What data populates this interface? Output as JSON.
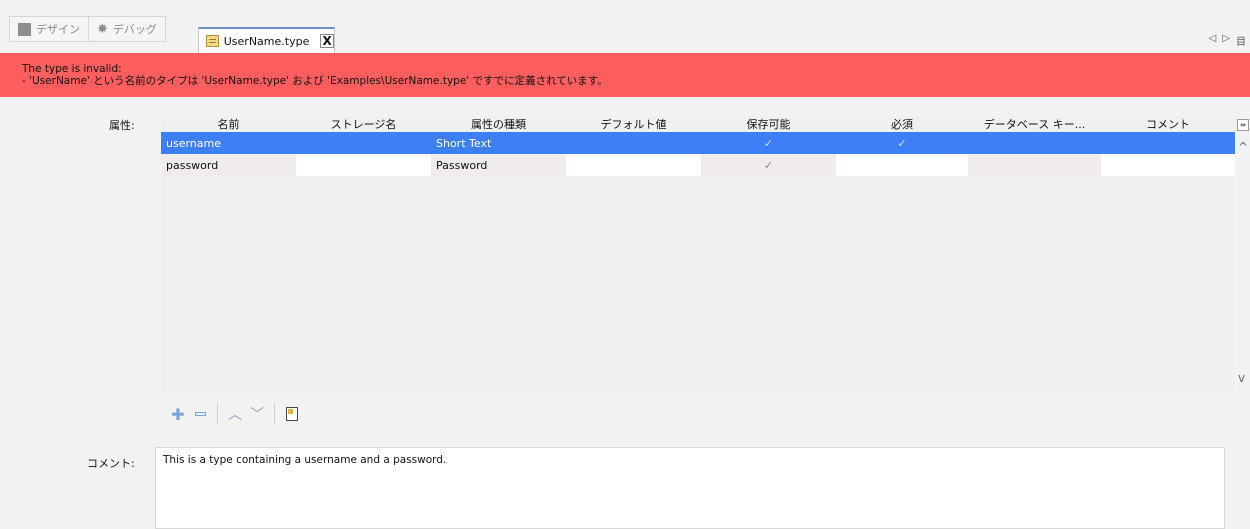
{
  "toolbar": {
    "design_label": "デザイン",
    "debug_label": "デバッグ"
  },
  "tab": {
    "title": "UserName.type",
    "close": "X",
    "icon": "type-file-icon"
  },
  "nav": {
    "prev": "◁",
    "next": "▷",
    "menu": "目"
  },
  "error": {
    "line1": "The type is invalid:",
    "line2": " - 'UserName' という名前のタイプは 'UserName.type' および 'Examples\\UserName.type' ですでに定義されています。",
    "color": "#ff5e5e"
  },
  "attributes": {
    "label": "属性:",
    "columns": [
      "名前",
      "ストレージ名",
      "属性の種類",
      "デフォルト値",
      "保存可能",
      "必須",
      "データベース キー...",
      "コメント"
    ],
    "rows": [
      {
        "name": "username",
        "storage": "",
        "type": "Short Text",
        "default": "",
        "saveable": "✓",
        "required": "✓",
        "db_key": "",
        "comment": ""
      },
      {
        "name": "password",
        "storage": "",
        "type": "Password",
        "default": "",
        "saveable": "✓",
        "required": "",
        "db_key": "",
        "comment": ""
      }
    ],
    "selected_color": "#3d7ff5"
  },
  "comment": {
    "label": "コメント:",
    "value": "This is a type containing a username and a password."
  }
}
